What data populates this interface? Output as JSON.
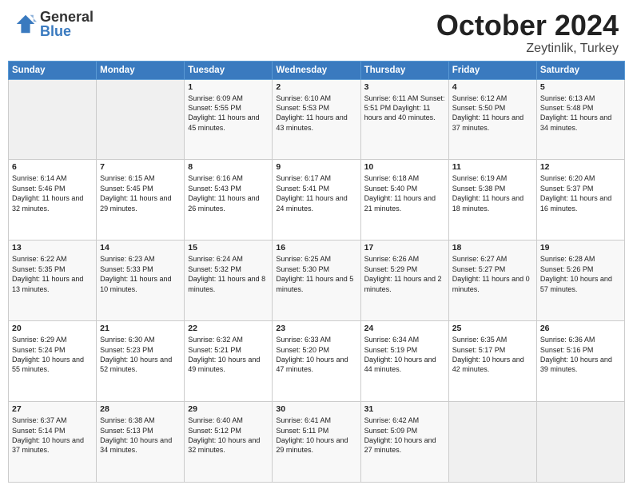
{
  "header": {
    "logo_general": "General",
    "logo_blue": "Blue",
    "month_title": "October 2024",
    "subtitle": "Zeytinlik, Turkey"
  },
  "weekdays": [
    "Sunday",
    "Monday",
    "Tuesday",
    "Wednesday",
    "Thursday",
    "Friday",
    "Saturday"
  ],
  "weeks": [
    [
      {
        "day": "",
        "info": ""
      },
      {
        "day": "",
        "info": ""
      },
      {
        "day": "1",
        "info": "Sunrise: 6:09 AM\nSunset: 5:55 PM\nDaylight: 11 hours and 45 minutes."
      },
      {
        "day": "2",
        "info": "Sunrise: 6:10 AM\nSunset: 5:53 PM\nDaylight: 11 hours and 43 minutes."
      },
      {
        "day": "3",
        "info": "Sunrise: 6:11 AM\nSunset: 5:51 PM\nDaylight: 11 hours and 40 minutes."
      },
      {
        "day": "4",
        "info": "Sunrise: 6:12 AM\nSunset: 5:50 PM\nDaylight: 11 hours and 37 minutes."
      },
      {
        "day": "5",
        "info": "Sunrise: 6:13 AM\nSunset: 5:48 PM\nDaylight: 11 hours and 34 minutes."
      }
    ],
    [
      {
        "day": "6",
        "info": "Sunrise: 6:14 AM\nSunset: 5:46 PM\nDaylight: 11 hours and 32 minutes."
      },
      {
        "day": "7",
        "info": "Sunrise: 6:15 AM\nSunset: 5:45 PM\nDaylight: 11 hours and 29 minutes."
      },
      {
        "day": "8",
        "info": "Sunrise: 6:16 AM\nSunset: 5:43 PM\nDaylight: 11 hours and 26 minutes."
      },
      {
        "day": "9",
        "info": "Sunrise: 6:17 AM\nSunset: 5:41 PM\nDaylight: 11 hours and 24 minutes."
      },
      {
        "day": "10",
        "info": "Sunrise: 6:18 AM\nSunset: 5:40 PM\nDaylight: 11 hours and 21 minutes."
      },
      {
        "day": "11",
        "info": "Sunrise: 6:19 AM\nSunset: 5:38 PM\nDaylight: 11 hours and 18 minutes."
      },
      {
        "day": "12",
        "info": "Sunrise: 6:20 AM\nSunset: 5:37 PM\nDaylight: 11 hours and 16 minutes."
      }
    ],
    [
      {
        "day": "13",
        "info": "Sunrise: 6:22 AM\nSunset: 5:35 PM\nDaylight: 11 hours and 13 minutes."
      },
      {
        "day": "14",
        "info": "Sunrise: 6:23 AM\nSunset: 5:33 PM\nDaylight: 11 hours and 10 minutes."
      },
      {
        "day": "15",
        "info": "Sunrise: 6:24 AM\nSunset: 5:32 PM\nDaylight: 11 hours and 8 minutes."
      },
      {
        "day": "16",
        "info": "Sunrise: 6:25 AM\nSunset: 5:30 PM\nDaylight: 11 hours and 5 minutes."
      },
      {
        "day": "17",
        "info": "Sunrise: 6:26 AM\nSunset: 5:29 PM\nDaylight: 11 hours and 2 minutes."
      },
      {
        "day": "18",
        "info": "Sunrise: 6:27 AM\nSunset: 5:27 PM\nDaylight: 11 hours and 0 minutes."
      },
      {
        "day": "19",
        "info": "Sunrise: 6:28 AM\nSunset: 5:26 PM\nDaylight: 10 hours and 57 minutes."
      }
    ],
    [
      {
        "day": "20",
        "info": "Sunrise: 6:29 AM\nSunset: 5:24 PM\nDaylight: 10 hours and 55 minutes."
      },
      {
        "day": "21",
        "info": "Sunrise: 6:30 AM\nSunset: 5:23 PM\nDaylight: 10 hours and 52 minutes."
      },
      {
        "day": "22",
        "info": "Sunrise: 6:32 AM\nSunset: 5:21 PM\nDaylight: 10 hours and 49 minutes."
      },
      {
        "day": "23",
        "info": "Sunrise: 6:33 AM\nSunset: 5:20 PM\nDaylight: 10 hours and 47 minutes."
      },
      {
        "day": "24",
        "info": "Sunrise: 6:34 AM\nSunset: 5:19 PM\nDaylight: 10 hours and 44 minutes."
      },
      {
        "day": "25",
        "info": "Sunrise: 6:35 AM\nSunset: 5:17 PM\nDaylight: 10 hours and 42 minutes."
      },
      {
        "day": "26",
        "info": "Sunrise: 6:36 AM\nSunset: 5:16 PM\nDaylight: 10 hours and 39 minutes."
      }
    ],
    [
      {
        "day": "27",
        "info": "Sunrise: 6:37 AM\nSunset: 5:14 PM\nDaylight: 10 hours and 37 minutes."
      },
      {
        "day": "28",
        "info": "Sunrise: 6:38 AM\nSunset: 5:13 PM\nDaylight: 10 hours and 34 minutes."
      },
      {
        "day": "29",
        "info": "Sunrise: 6:40 AM\nSunset: 5:12 PM\nDaylight: 10 hours and 32 minutes."
      },
      {
        "day": "30",
        "info": "Sunrise: 6:41 AM\nSunset: 5:11 PM\nDaylight: 10 hours and 29 minutes."
      },
      {
        "day": "31",
        "info": "Sunrise: 6:42 AM\nSunset: 5:09 PM\nDaylight: 10 hours and 27 minutes."
      },
      {
        "day": "",
        "info": ""
      },
      {
        "day": "",
        "info": ""
      }
    ]
  ]
}
